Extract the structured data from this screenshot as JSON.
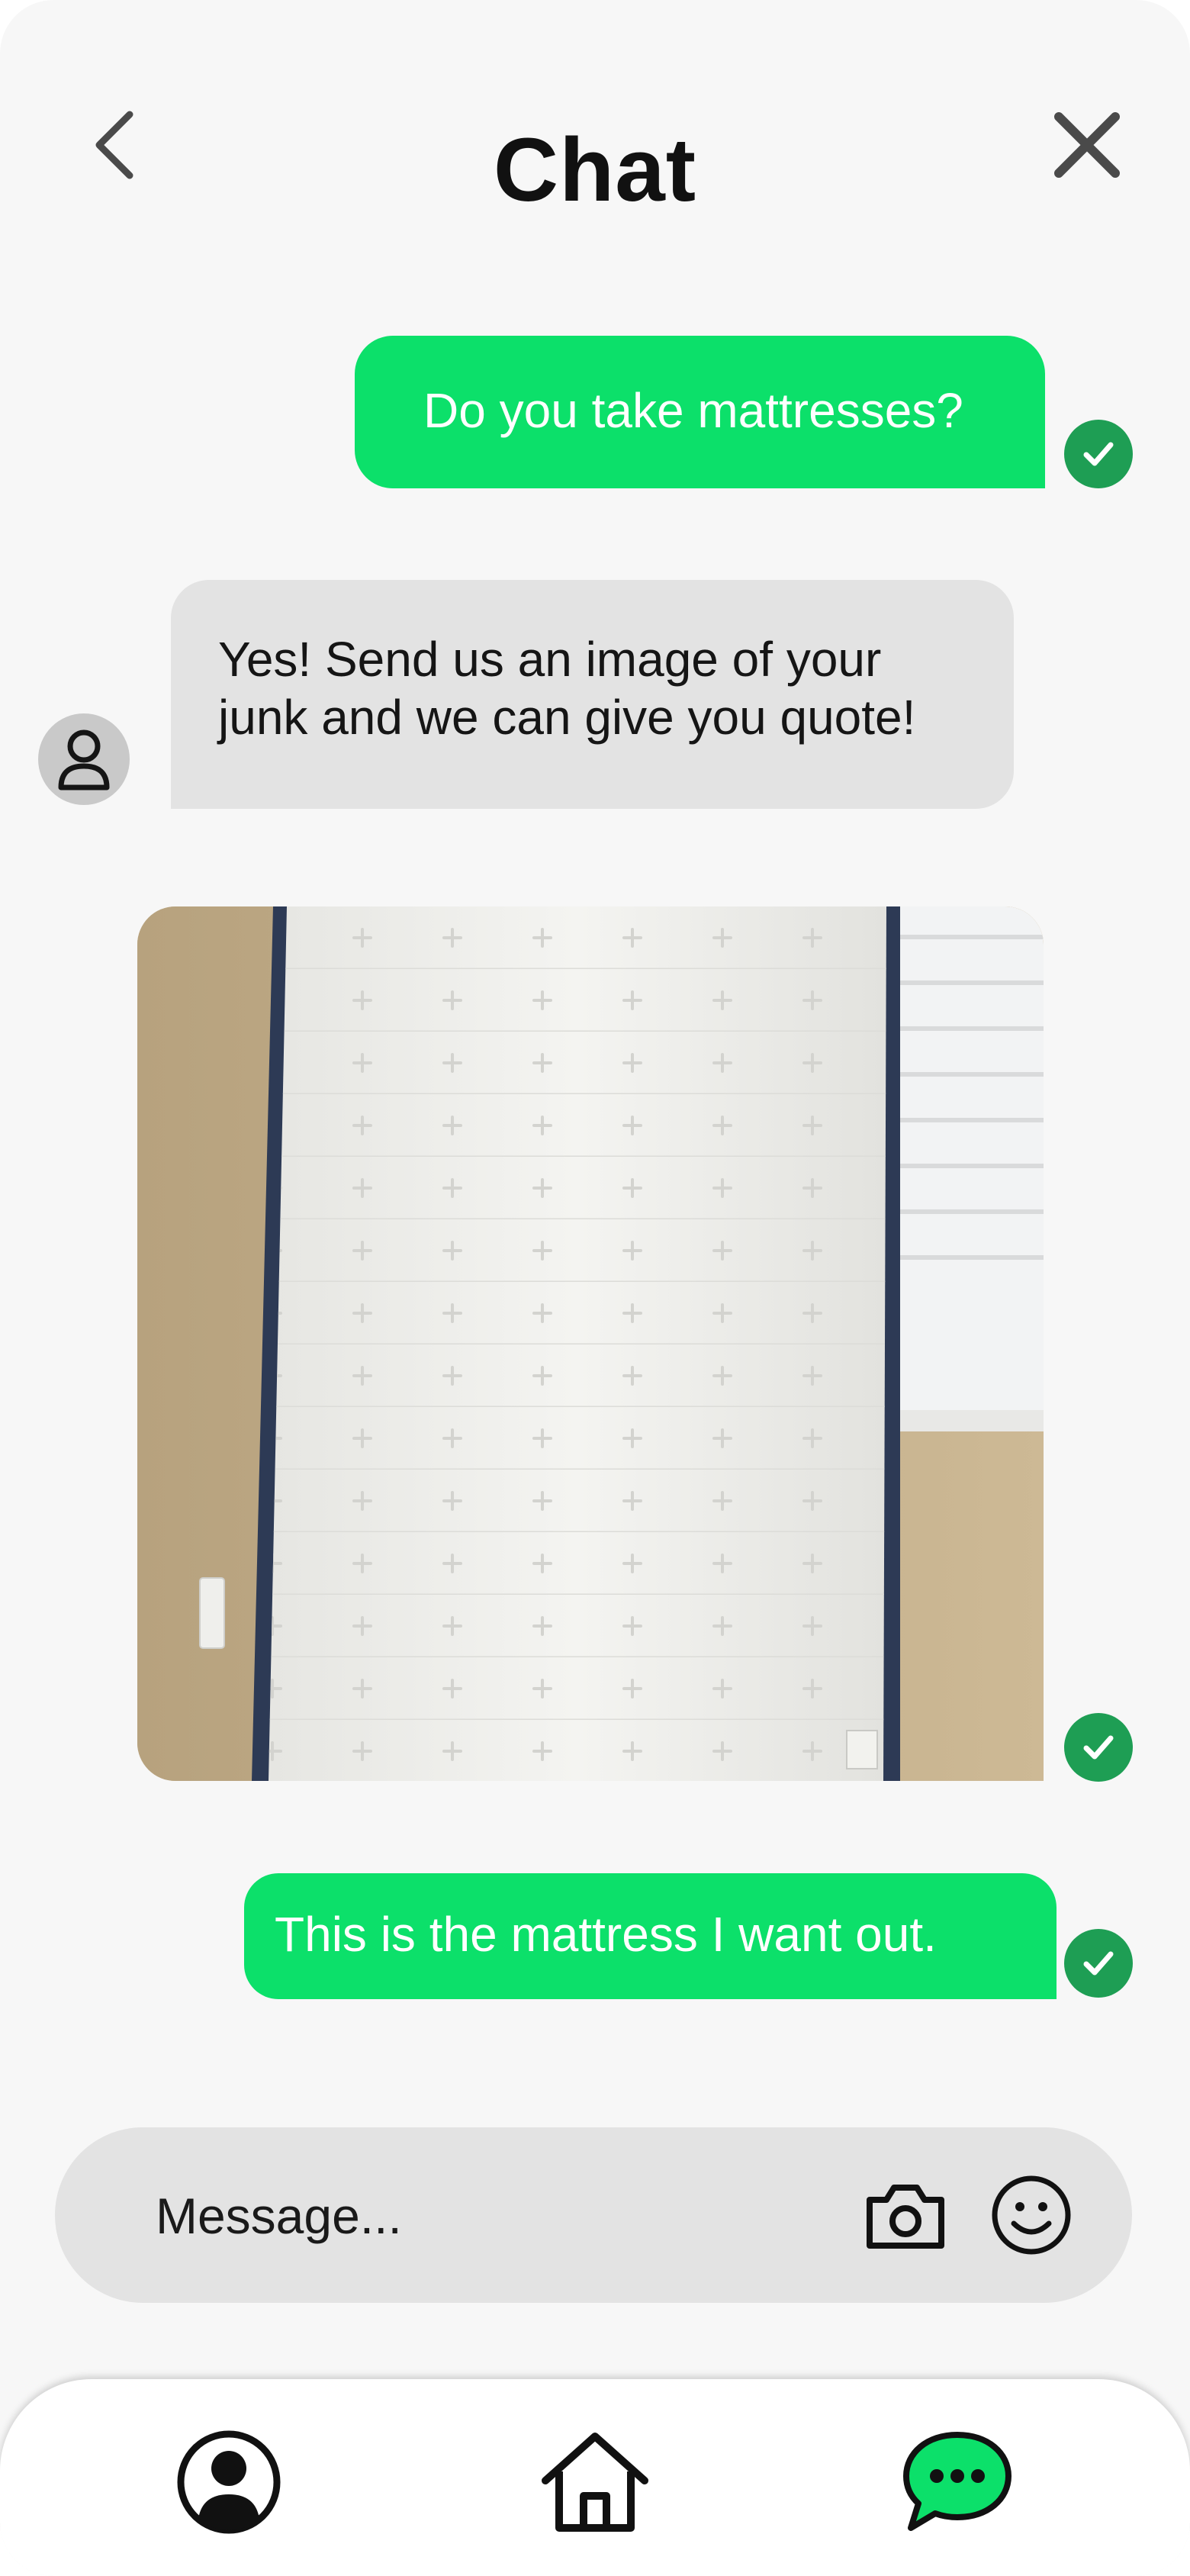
{
  "header": {
    "title": "Chat",
    "back_icon": "chevron-left-icon",
    "close_icon": "close-icon"
  },
  "messages": [
    {
      "direction": "outgoing",
      "type": "text",
      "text": "Do you take mattresses?",
      "status_icon": "check-circle-icon"
    },
    {
      "direction": "incoming",
      "type": "text",
      "text": "Yes! Send us an image of your junk and we can give you quote!",
      "avatar_icon": "user-avatar-icon"
    },
    {
      "direction": "outgoing",
      "type": "image",
      "content": "photo of a mattress leaning against a wall",
      "status_icon": "check-circle-icon"
    },
    {
      "direction": "outgoing",
      "type": "text",
      "text": "This is the mattress I want out.",
      "status_icon": "check-circle-icon"
    }
  ],
  "composer": {
    "placeholder": "Message...",
    "camera_icon": "camera-icon",
    "emoji_icon": "smiley-icon"
  },
  "bottom_nav": {
    "items": [
      {
        "name": "profile",
        "icon": "profile-icon",
        "active": false
      },
      {
        "name": "home",
        "icon": "home-icon",
        "active": false
      },
      {
        "name": "chat",
        "icon": "chat-icon",
        "active": true
      }
    ]
  },
  "colors": {
    "outgoing_bubble": "#0ce06a",
    "incoming_bubble": "#e3e3e3",
    "read_check": "#1e9e54",
    "background": "#f7f7f7"
  }
}
